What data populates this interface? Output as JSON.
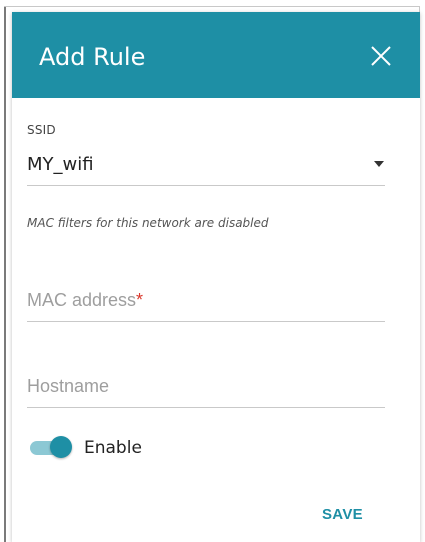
{
  "dialog": {
    "title": "Add Rule",
    "close_icon": "close-icon",
    "accent_color": "#1e8fa5"
  },
  "ssid": {
    "label": "SSID",
    "value": "MY_wifi",
    "dropdown_icon": "caret-down-icon"
  },
  "note": "MAC filters for this network are disabled",
  "mac_address": {
    "placeholder": "MAC address",
    "required_marker": "*",
    "value": ""
  },
  "hostname": {
    "placeholder": "Hostname",
    "value": ""
  },
  "enable_toggle": {
    "label": "Enable",
    "checked": true
  },
  "actions": {
    "save_label": "SAVE"
  }
}
